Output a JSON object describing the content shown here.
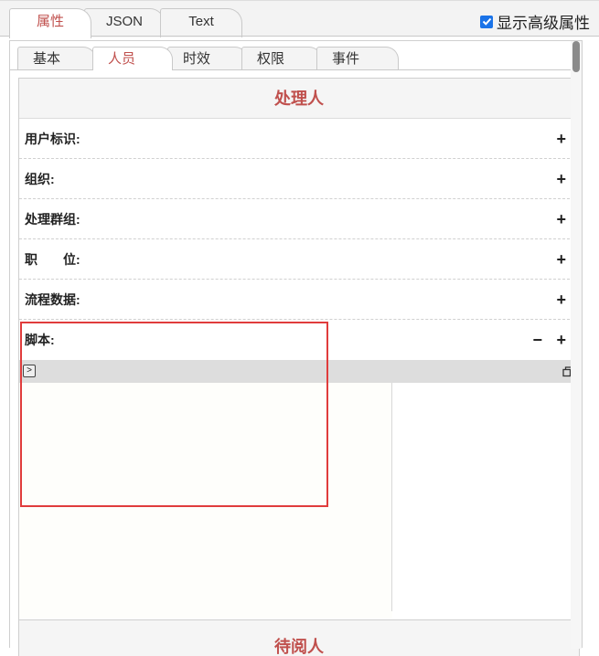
{
  "outer_tabs": [
    "属性",
    "JSON",
    "Text"
  ],
  "show_advanced": {
    "label": "显示高级属性",
    "checked": true
  },
  "inner_tabs": [
    "基本",
    "人员",
    "时效",
    "权限",
    "事件"
  ],
  "section_title": "处理人",
  "rows": [
    {
      "label": "用户标识:"
    },
    {
      "label": "组织:"
    },
    {
      "label": "处理群组:"
    },
    {
      "label": "职　　位:"
    },
    {
      "label": "流程数据:"
    },
    {
      "label": "脚本:"
    }
  ],
  "plus_symbol": "+",
  "minus_symbol": "−",
  "next_section_title": "待阅人",
  "colors": {
    "accent": "#c0504d",
    "highlight": "#e03c3c",
    "checkbox": "#1a73e8"
  }
}
